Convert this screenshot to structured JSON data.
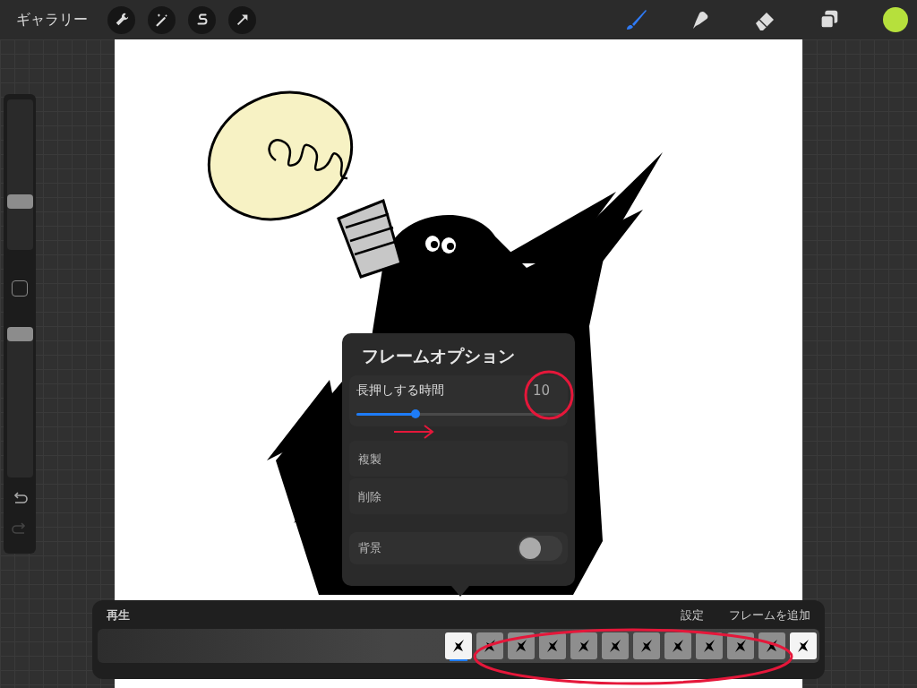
{
  "top_bar": {
    "gallery_button": "ギャラリー",
    "tools": [
      {
        "kind": "brush",
        "selected": true
      },
      {
        "kind": "smudge",
        "selected": false
      },
      {
        "kind": "eraser",
        "selected": false
      }
    ]
  },
  "sidebar": {
    "brush_size": {
      "level": 0.32
    },
    "opacity": {
      "level": 0.95
    }
  },
  "frame_options": {
    "title": "フレームオプション",
    "hold_duration": {
      "label": "長押しする時間",
      "value": "10",
      "level": 0.29
    },
    "actions": [
      "複製",
      "削除"
    ],
    "background": {
      "label": "背景",
      "on": false
    }
  },
  "timeline": {
    "play": "再生",
    "settings": "設定",
    "add_frame": "フレームを追加",
    "frames": [
      {
        "selected": true,
        "onion": false
      },
      {
        "selected": false,
        "onion": true
      },
      {
        "selected": false,
        "onion": true
      },
      {
        "selected": false,
        "onion": true
      },
      {
        "selected": false,
        "onion": true
      },
      {
        "selected": false,
        "onion": true
      },
      {
        "selected": false,
        "onion": true
      },
      {
        "selected": false,
        "onion": true
      },
      {
        "selected": false,
        "onion": true
      },
      {
        "selected": false,
        "onion": true
      },
      {
        "selected": false,
        "onion": true
      },
      {
        "selected": false,
        "onion": false
      }
    ]
  }
}
